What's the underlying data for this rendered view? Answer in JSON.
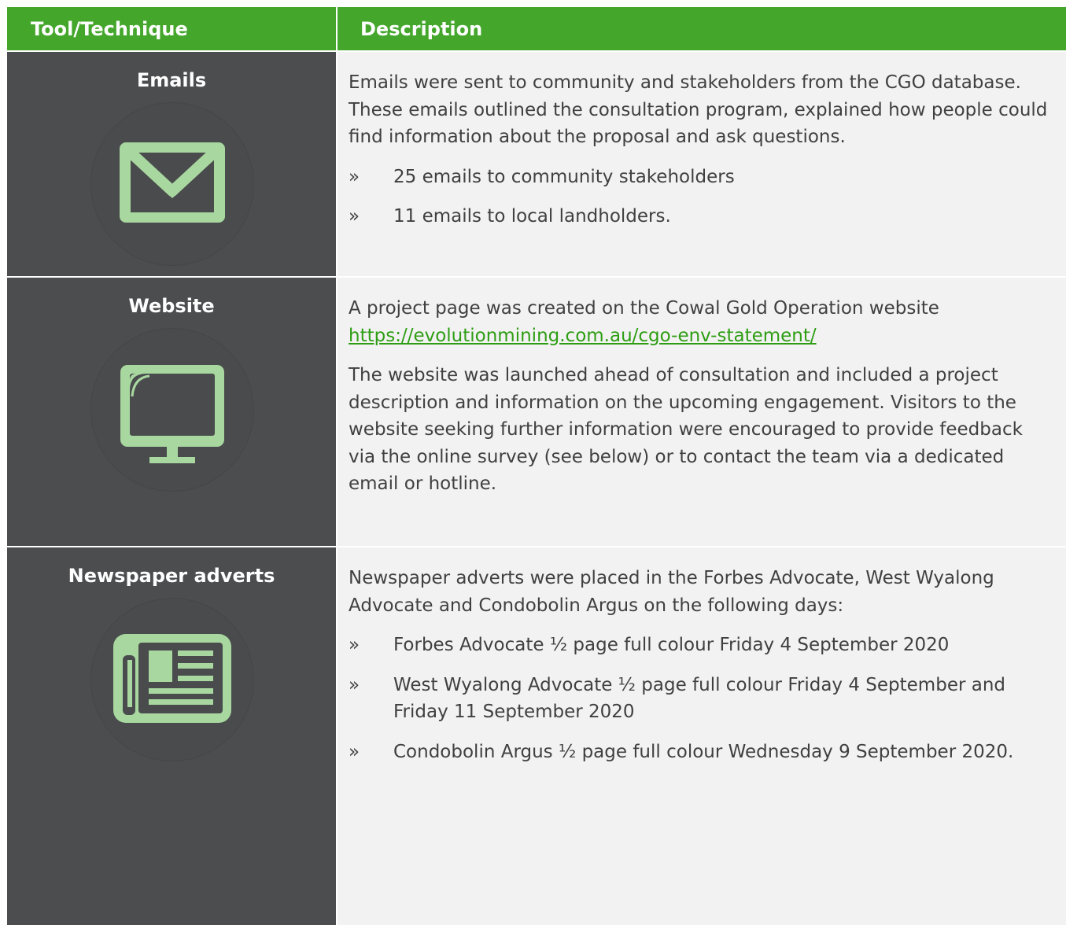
{
  "header": {
    "col1": "Tool/Technique",
    "col2": "Description"
  },
  "colors": {
    "header_green": "#44a72c",
    "left_dark": "#4c4d4f",
    "right_light": "#f2f2f2",
    "icon_green": "#a8d8a0",
    "link_green": "#2e9d14"
  },
  "bullet_mark": "»",
  "rows": [
    {
      "title": "Emails",
      "icon": "envelope-icon",
      "paragraph": "Emails were sent to community and stakeholders from the CGO database. These emails outlined the consultation program, explained how people could find information about the proposal and ask questions.",
      "bullets": [
        "25 emails to community stakeholders",
        "11 emails to local landholders."
      ]
    },
    {
      "title": "Website",
      "icon": "monitor-icon",
      "paragraph_lead": "A project page was created on the Cowal Gold Operation website",
      "link": "https://evolutionmining.com.au/cgo-env-statement/",
      "paragraph2": "The website was launched ahead of consultation and included a project description and information on the upcoming engagement. Visitors to the website seeking further information were encouraged to provide feedback via the online survey (see below) or to contact the team via a dedicated email or hotline."
    },
    {
      "title": "Newspaper adverts",
      "icon": "newspaper-icon",
      "paragraph": "Newspaper adverts were placed in the Forbes Advocate, West Wyalong Advocate and Condobolin Argus on the following days:",
      "bullets": [
        "Forbes Advocate ½ page full colour Friday 4 September 2020",
        "West Wyalong Advocate ½ page full colour Friday 4 September and Friday 11 September 2020",
        "Condobolin Argus ½ page full colour Wednesday 9 September 2020."
      ]
    }
  ]
}
